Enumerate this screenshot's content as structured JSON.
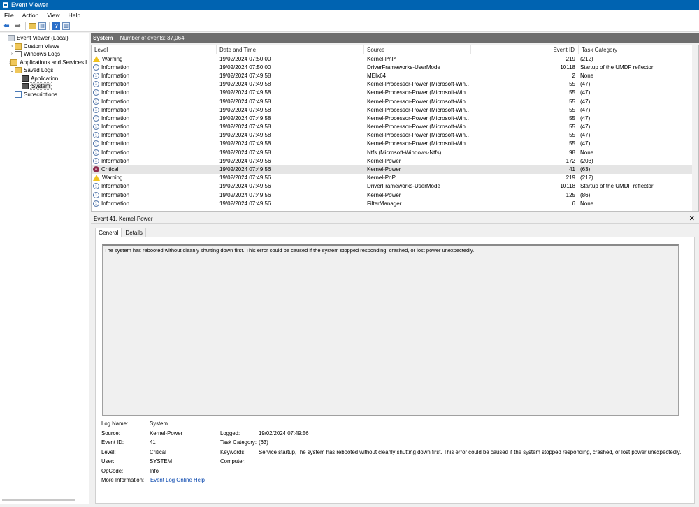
{
  "window": {
    "title": "Event Viewer"
  },
  "menu": [
    "File",
    "Action",
    "View",
    "Help"
  ],
  "tree": {
    "items": [
      {
        "label": "Event Viewer (Local)",
        "indent": 0,
        "exp": "",
        "icon": "ev"
      },
      {
        "label": "Custom Views",
        "indent": 1,
        "exp": "›",
        "icon": "folder"
      },
      {
        "label": "Windows Logs",
        "indent": 1,
        "exp": "›",
        "icon": "doc"
      },
      {
        "label": "Applications and Services Lo",
        "indent": 1,
        "exp": "›",
        "icon": "folder"
      },
      {
        "label": "Saved Logs",
        "indent": 1,
        "exp": "⌄",
        "icon": "folder"
      },
      {
        "label": "Application",
        "indent": 2,
        "exp": "",
        "icon": "disk"
      },
      {
        "label": "System",
        "indent": 2,
        "exp": "",
        "icon": "disk",
        "selected": true
      },
      {
        "label": "Subscriptions",
        "indent": 1,
        "exp": "",
        "icon": "sub"
      }
    ]
  },
  "section": {
    "title": "System",
    "count": "Number of events: 37,064"
  },
  "columns": {
    "level": "Level",
    "date": "Date and Time",
    "source": "Source",
    "id": "Event ID",
    "task": "Task Category"
  },
  "events": [
    {
      "level": "Warning",
      "date": "19/02/2024 07:50:00",
      "source": "Kernel-PnP",
      "id": "219",
      "task": "(212)"
    },
    {
      "level": "Information",
      "date": "19/02/2024 07:50:00",
      "source": "DriverFrameworks-UserMode",
      "id": "10118",
      "task": "Startup of the UMDF reflector"
    },
    {
      "level": "Information",
      "date": "19/02/2024 07:49:58",
      "source": "MEIx64",
      "id": "2",
      "task": "None"
    },
    {
      "level": "Information",
      "date": "19/02/2024 07:49:58",
      "source": "Kernel-Processor-Power (Microsoft-Wind...",
      "id": "55",
      "task": "(47)"
    },
    {
      "level": "Information",
      "date": "19/02/2024 07:49:58",
      "source": "Kernel-Processor-Power (Microsoft-Wind...",
      "id": "55",
      "task": "(47)"
    },
    {
      "level": "Information",
      "date": "19/02/2024 07:49:58",
      "source": "Kernel-Processor-Power (Microsoft-Wind...",
      "id": "55",
      "task": "(47)"
    },
    {
      "level": "Information",
      "date": "19/02/2024 07:49:58",
      "source": "Kernel-Processor-Power (Microsoft-Wind...",
      "id": "55",
      "task": "(47)"
    },
    {
      "level": "Information",
      "date": "19/02/2024 07:49:58",
      "source": "Kernel-Processor-Power (Microsoft-Wind...",
      "id": "55",
      "task": "(47)"
    },
    {
      "level": "Information",
      "date": "19/02/2024 07:49:58",
      "source": "Kernel-Processor-Power (Microsoft-Wind...",
      "id": "55",
      "task": "(47)"
    },
    {
      "level": "Information",
      "date": "19/02/2024 07:49:58",
      "source": "Kernel-Processor-Power (Microsoft-Wind...",
      "id": "55",
      "task": "(47)"
    },
    {
      "level": "Information",
      "date": "19/02/2024 07:49:58",
      "source": "Kernel-Processor-Power (Microsoft-Wind...",
      "id": "55",
      "task": "(47)"
    },
    {
      "level": "Information",
      "date": "19/02/2024 07:49:58",
      "source": "Ntfs (Microsoft-Windows-Ntfs)",
      "id": "98",
      "task": "None"
    },
    {
      "level": "Information",
      "date": "19/02/2024 07:49:56",
      "source": "Kernel-Power",
      "id": "172",
      "task": "(203)"
    },
    {
      "level": "Critical",
      "date": "19/02/2024 07:49:56",
      "source": "Kernel-Power",
      "id": "41",
      "task": "(63)",
      "selected": true
    },
    {
      "level": "Warning",
      "date": "19/02/2024 07:49:56",
      "source": "Kernel-PnP",
      "id": "219",
      "task": "(212)"
    },
    {
      "level": "Information",
      "date": "19/02/2024 07:49:56",
      "source": "DriverFrameworks-UserMode",
      "id": "10118",
      "task": "Startup of the UMDF reflector"
    },
    {
      "level": "Information",
      "date": "19/02/2024 07:49:56",
      "source": "Kernel-Power",
      "id": "125",
      "task": "(86)"
    },
    {
      "level": "Information",
      "date": "19/02/2024 07:49:56",
      "source": "FilterManager",
      "id": "6",
      "task": "None"
    }
  ],
  "detail": {
    "header": "Event 41, Kernel-Power",
    "tabs": [
      "General",
      "Details"
    ],
    "description": "The system has rebooted without cleanly shutting down first. This error could be caused if the system stopped responding, crashed, or lost power unexpectedly.",
    "props": {
      "log_name_label": "Log Name:",
      "log_name": "System",
      "source_label": "Source:",
      "source": "Kernel-Power",
      "logged_label": "Logged:",
      "logged": "19/02/2024 07:49:56",
      "event_id_label": "Event ID:",
      "event_id": "41",
      "task_label": "Task Category:",
      "task": "(63)",
      "level_label": "Level:",
      "level": "Critical",
      "keywords_label": "Keywords:",
      "keywords": "Service startup,The system has rebooted without cleanly shutting down first. This error could be caused if the system stopped responding, crashed, or lost power unexpectedly.",
      "user_label": "User:",
      "user": "SYSTEM",
      "computer_label": "Computer:",
      "computer": "",
      "opcode_label": "OpCode:",
      "opcode": "Info",
      "more_info_label": "More Information:",
      "more_info_link": "Event Log Online Help"
    }
  }
}
